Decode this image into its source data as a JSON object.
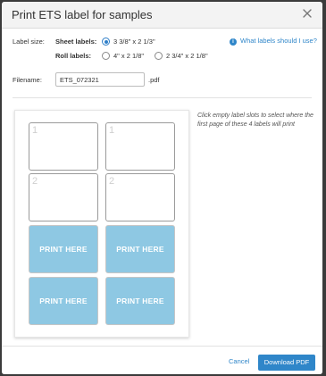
{
  "dialog": {
    "title": "Print ETS label for samples",
    "close_icon": "close-icon"
  },
  "form": {
    "label_size_label": "Label size:",
    "sheet_labels_label": "Sheet labels:",
    "roll_labels_label": "Roll labels:",
    "options": [
      {
        "label": "3 3/8\" x 2 1/3\"",
        "selected": true
      },
      {
        "label": "4\" x 2 1/8\"",
        "selected": false
      },
      {
        "label": "2 3/4\" x 2 1/8\"",
        "selected": false
      }
    ],
    "help_link": "What labels should I use?",
    "help_icon": "info-icon",
    "filename_label": "Filename:",
    "filename_value": "ETS_072321",
    "extension": ".pdf"
  },
  "sheet": {
    "slots": [
      {
        "number": "1",
        "print": false
      },
      {
        "number": "1",
        "print": false
      },
      {
        "number": "2",
        "print": false
      },
      {
        "number": "2",
        "print": false
      },
      {
        "number": "",
        "print": true,
        "text": "PRINT HERE"
      },
      {
        "number": "",
        "print": true,
        "text": "PRINT HERE"
      },
      {
        "number": "",
        "print": true,
        "text": "PRINT HERE"
      },
      {
        "number": "",
        "print": true,
        "text": "PRINT HERE"
      }
    ],
    "instruction": "Click empty label slots to select where the first page of these 4 labels will print"
  },
  "footer": {
    "cancel_label": "Cancel",
    "download_label": "Download PDF"
  },
  "colors": {
    "accent": "#2f86c9",
    "print_slot": "#8ec8e3"
  }
}
